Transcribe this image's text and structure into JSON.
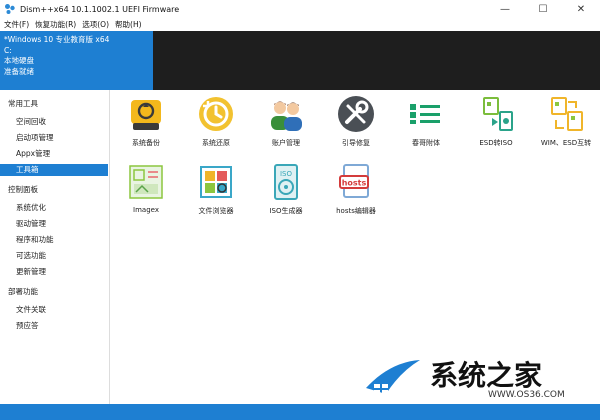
{
  "window": {
    "title": "Dism++x64 10.1.1002.1 UEFI Firmware",
    "controls": {
      "minimize": "—",
      "maximize": "☐",
      "close": "✕"
    }
  },
  "menu": [
    "文件(F)",
    "恢复功能(R)",
    "选项(O)",
    "帮助(H)"
  ],
  "header": {
    "lines": [
      "*Windows 10 专业教育版 x64",
      "C:",
      "本地硬盘",
      "准备就绪"
    ]
  },
  "sidebar": {
    "groups": [
      {
        "label": "常用工具",
        "items": [
          "空间回收",
          "启动项管理",
          "Appx管理",
          "工具箱"
        ]
      },
      {
        "label": "控制面板",
        "items": [
          "系统优化",
          "驱动管理",
          "程序和功能",
          "可选功能",
          "更新管理"
        ]
      },
      {
        "label": "部署功能",
        "items": [
          "文件关联",
          "预应答"
        ]
      }
    ],
    "active_item": "工具箱"
  },
  "tools": [
    {
      "label": "系统备份",
      "icon": "backup-drive-icon"
    },
    {
      "label": "系统还原",
      "icon": "restore-clock-icon"
    },
    {
      "label": "账户管理",
      "icon": "users-icon"
    },
    {
      "label": "引导修复",
      "icon": "wrench-screwdriver-icon"
    },
    {
      "label": "春哥附体",
      "icon": "toggle-switches-icon"
    },
    {
      "label": "ESD转ISO",
      "icon": "esd-iso-convert-icon"
    },
    {
      "label": "WIM、ESD互转",
      "icon": "wim-esd-convert-icon"
    },
    {
      "label": "Imagex",
      "icon": "imagex-icon"
    },
    {
      "label": "文件浏览器",
      "icon": "file-browser-icon"
    },
    {
      "label": "ISO生成器",
      "icon": "iso-maker-icon"
    },
    {
      "label": "hosts编辑器",
      "icon": "hosts-editor-icon"
    }
  ],
  "watermark": {
    "text": "系统之家",
    "url": "WWW.OS36.COM"
  },
  "colors": {
    "accent": "#1e7fd2",
    "header_dark": "#1e1e1e"
  }
}
